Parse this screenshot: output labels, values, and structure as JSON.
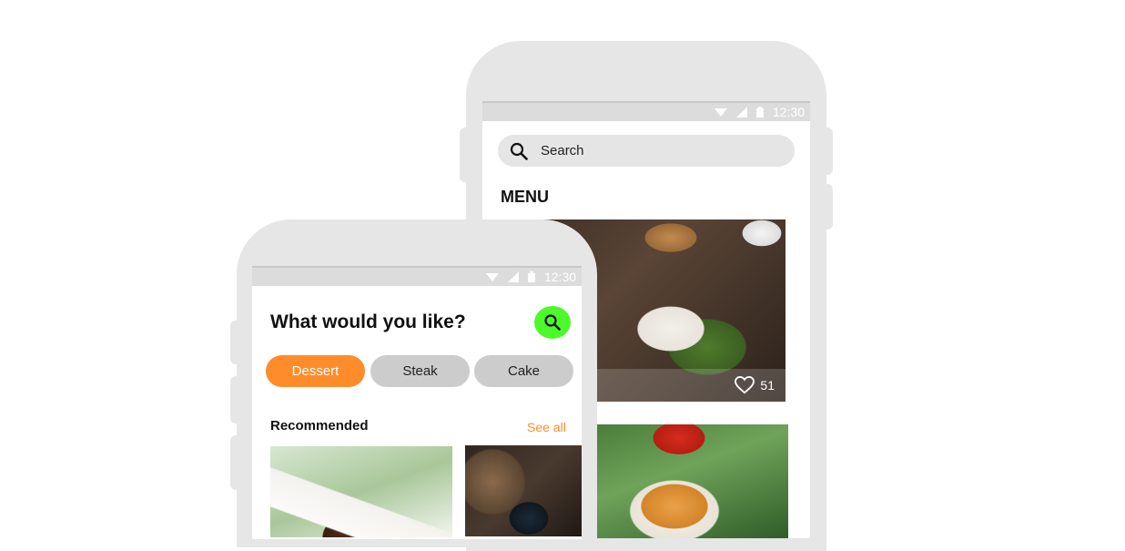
{
  "back_phone": {
    "status_time": "12:30",
    "search": {
      "placeholder": "Search"
    },
    "menu_title": "MENU",
    "items": [
      {
        "likes": "51"
      }
    ]
  },
  "front_phone": {
    "status_time": "12:30",
    "headline": "What would you like?",
    "categories": [
      {
        "label": "Dessert",
        "selected": true
      },
      {
        "label": "Steak",
        "selected": false
      },
      {
        "label": "Cake",
        "selected": false
      }
    ],
    "recommended_label": "Recommended",
    "see_all": "See all"
  },
  "colors": {
    "accent": "#ff8c2a",
    "search_button": "#4cfa2c",
    "phone_frame": "#e6e6e6",
    "chip_inactive": "#cccccc"
  },
  "icons": [
    "wifi-icon",
    "signal-icon",
    "battery-icon",
    "search-icon",
    "heart-icon"
  ]
}
